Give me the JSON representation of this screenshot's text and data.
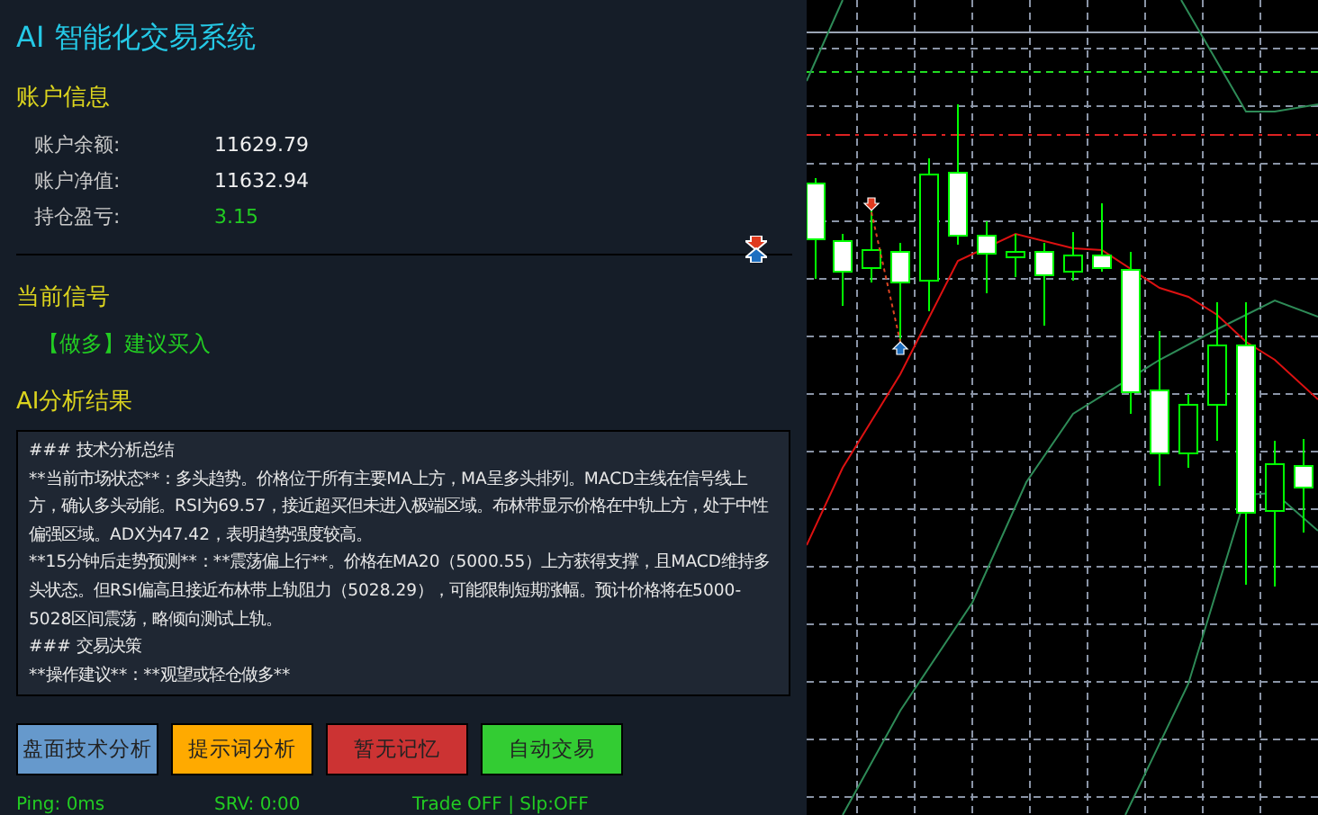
{
  "title": "AI 智能化交易系统",
  "account": {
    "heading": "账户信息",
    "rows": [
      {
        "label": "账户余额:",
        "value": "11629.79",
        "kind": "plain"
      },
      {
        "label": "账户净值:",
        "value": "11632.94",
        "kind": "plain"
      },
      {
        "label": "持仓盈亏:",
        "value": "3.15",
        "kind": "profit"
      }
    ]
  },
  "signal": {
    "heading": "当前信号",
    "text": "【做多】建议买入"
  },
  "analysis": {
    "heading": "AI分析结果",
    "paragraphs": [
      "### 技术分析总结",
      "**当前市场状态**：多头趋势。价格位于所有主要MA上方，MA呈多头排列。MACD主线在信号线上方，确认多头动能。RSI为69.57，接近超买但未进入极端区域。布林带显示价格在中轨上方，处于中性偏强区域。ADX为47.42，表明趋势强度较高。",
      "**15分钟后走势预测**：**震荡偏上行**。价格在MA20（5000.55）上方获得支撑，且MACD维持多头状态。但RSI偏高且接近布林带上轨阻力（5028.29），可能限制短期涨幅。预计价格将在5000-5028区间震荡，略倾向测试上轨。",
      "### 交易决策",
      "**操作建议**：**观望或轻仓做多**"
    ]
  },
  "buttons": [
    {
      "label": "盘面技术分析",
      "color": "#6699cc"
    },
    {
      "label": "提示词分析",
      "color": "#ffaa00"
    },
    {
      "label": "暂无记忆",
      "color": "#cc3333"
    },
    {
      "label": "自动交易",
      "color": "#33cc33"
    }
  ],
  "status_bar": [
    "Ping: 0ms",
    "SRV: 0:00",
    "Trade OFF | Slp:OFF"
  ]
}
